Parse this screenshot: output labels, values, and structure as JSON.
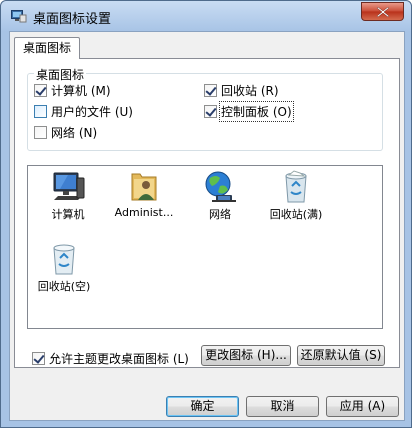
{
  "window": {
    "title": "桌面图标设置"
  },
  "tabs": [
    {
      "label": "桌面图标"
    }
  ],
  "group": {
    "title": "桌面图标",
    "items": [
      {
        "label": "计算机 (M)",
        "checked": true
      },
      {
        "label": "回收站 (R)",
        "checked": true
      },
      {
        "label": "用户的文件 (U)",
        "checked": false
      },
      {
        "label": "控制面板 (O)",
        "checked": true
      },
      {
        "label": "网络 (N)",
        "checked": false
      }
    ]
  },
  "icons": [
    {
      "label": "计算机",
      "icon": "computer-icon"
    },
    {
      "label": "Administ...",
      "icon": "user-folder-icon"
    },
    {
      "label": "网络",
      "icon": "network-globe-icon"
    },
    {
      "label": "回收站(满)",
      "icon": "recycle-bin-full-icon"
    },
    {
      "label": "回收站(空)",
      "icon": "recycle-bin-empty-icon"
    }
  ],
  "buttons": {
    "change_icon": "更改图标 (H)...",
    "restore_default": "还原默认值 (S)",
    "ok": "确定",
    "cancel": "取消",
    "apply": "应用 (A)"
  },
  "allow_themes": {
    "label": "允许主题更改桌面图标 (L)",
    "checked": true
  }
}
